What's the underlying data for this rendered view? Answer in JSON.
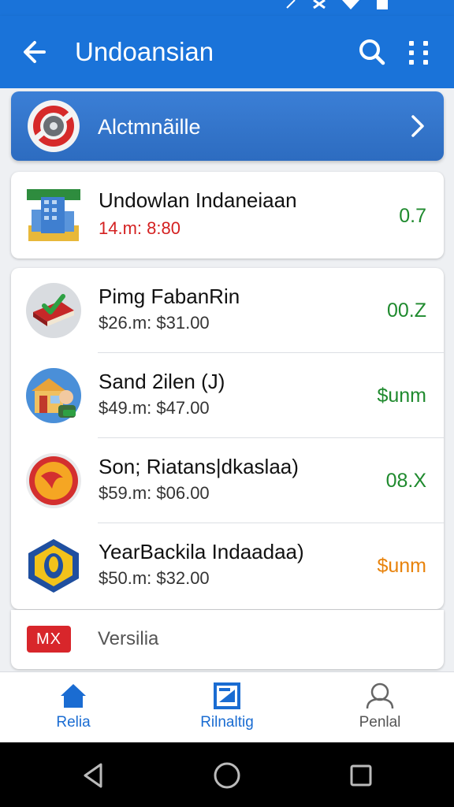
{
  "app_bar": {
    "title": "Undoansian",
    "back_icon": "arrow-back-icon",
    "search_icon": "search-icon",
    "more_icon": "more-vertical-icon",
    "color": "#1a73d9"
  },
  "banner": {
    "label": "Alctmnãille",
    "icon": "lifebuoy-gear-icon",
    "chevron_icon": "chevron-right-icon"
  },
  "featured_item": {
    "title": "Undowlan Indaneiaan",
    "subtitle": "14.m: 8:80",
    "value": "0.7",
    "icon": "building-icon"
  },
  "items": [
    {
      "title": "Pimg FabanRin",
      "subtitle": "$26.m: $31.00",
      "value": "00.Z",
      "icon": "book-check-icon",
      "value_color": "green"
    },
    {
      "title": "Sand 2ilen (J)",
      "subtitle": "$49.m: $47.00",
      "value": "$unm",
      "icon": "shop-person-icon",
      "value_color": "green"
    },
    {
      "title": "Son; Riatans|dkaslaa)",
      "subtitle": "$59.m: $06.00",
      "value": "08.X",
      "icon": "red-circle-icon",
      "value_color": "green"
    },
    {
      "title": "YearBackila Indaadaa)",
      "subtitle": "$50.m: $32.00",
      "value": "$unm",
      "icon": "hexagon-shield-icon",
      "value_color": "orange"
    }
  ],
  "footer_item": {
    "badge": "MX",
    "label": "Versilia"
  },
  "bottom_nav": [
    {
      "label": "Relia",
      "icon": "home-icon",
      "active": true
    },
    {
      "label": "Rilnaltig",
      "icon": "chart-card-icon",
      "active": true
    },
    {
      "label": "Penlal",
      "icon": "person-icon",
      "active": false
    }
  ],
  "system_nav": {
    "back_icon": "triangle-back-icon",
    "home_icon": "circle-home-icon",
    "recents_icon": "square-recents-icon"
  }
}
